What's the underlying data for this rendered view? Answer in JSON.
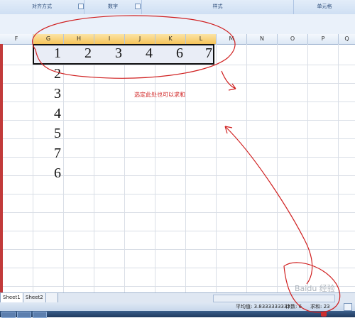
{
  "ribbon": {
    "groups": [
      {
        "label": "对齐方式"
      },
      {
        "label": "数字"
      },
      {
        "label": "样式"
      },
      {
        "label": "单元格"
      }
    ]
  },
  "columns": [
    "F",
    "G",
    "H",
    "I",
    "J",
    "K",
    "L",
    "M",
    "N",
    "O",
    "P",
    "Q"
  ],
  "selected_row_values": [
    "1",
    "2",
    "3",
    "4",
    "6",
    "7"
  ],
  "column_g_values": [
    "2",
    "3",
    "4",
    "5",
    "7",
    "6"
  ],
  "annotation_note": "选定此处也可以求和",
  "sheet_tabs": [
    "Sheet1",
    "Sheet2"
  ],
  "status": {
    "average": "平均值: 3.8333333333",
    "count": "计数: 6",
    "sum": "求和: 23"
  },
  "watermark": "Baidu 经验",
  "colors": {
    "selection_header": "#f6c45a",
    "annotation": "#d02020",
    "ribbon": "#dbe6f4"
  }
}
